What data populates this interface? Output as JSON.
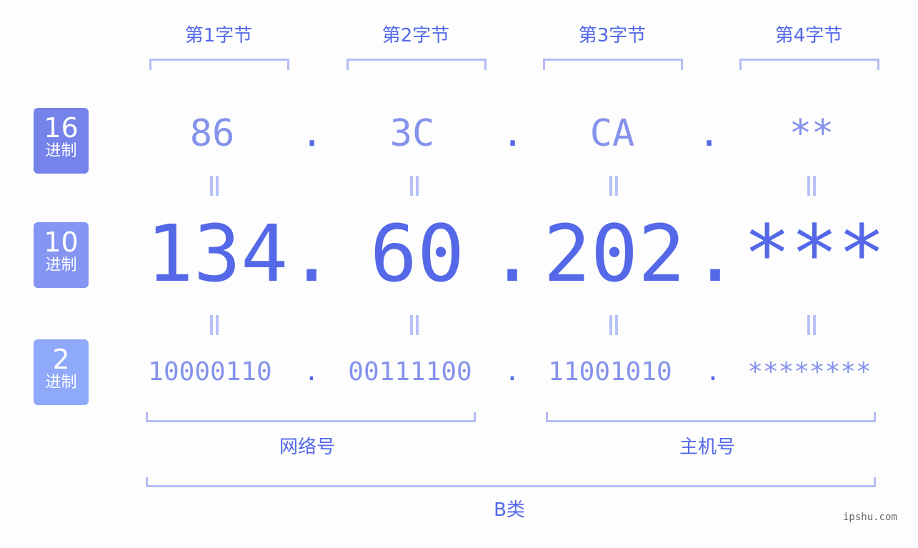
{
  "bytes": [
    {
      "label": "第1字节",
      "hex": "86",
      "dec": "134",
      "bin": "10000110"
    },
    {
      "label": "第2字节",
      "hex": "3C",
      "dec": "60",
      "bin": "00111100"
    },
    {
      "label": "第3字节",
      "hex": "CA",
      "dec": "202",
      "bin": "11001010"
    },
    {
      "label": "第4字节",
      "hex": "**",
      "dec": "***",
      "bin": "********"
    }
  ],
  "separator": ".",
  "badges": [
    {
      "num": "16",
      "sub": "进制",
      "color": "#7583eb"
    },
    {
      "num": "10",
      "sub": "进制",
      "color": "#8595f2"
    },
    {
      "num": "2",
      "sub": "进制",
      "color": "#8ea8fa"
    }
  ],
  "groups": {
    "network": "网络号",
    "host": "主机号",
    "class": "B类"
  },
  "watermark": "ipshu.com",
  "colors": {
    "accent": "#5468e8",
    "light": "#8592ec",
    "bracket": "#b3bdf6"
  }
}
